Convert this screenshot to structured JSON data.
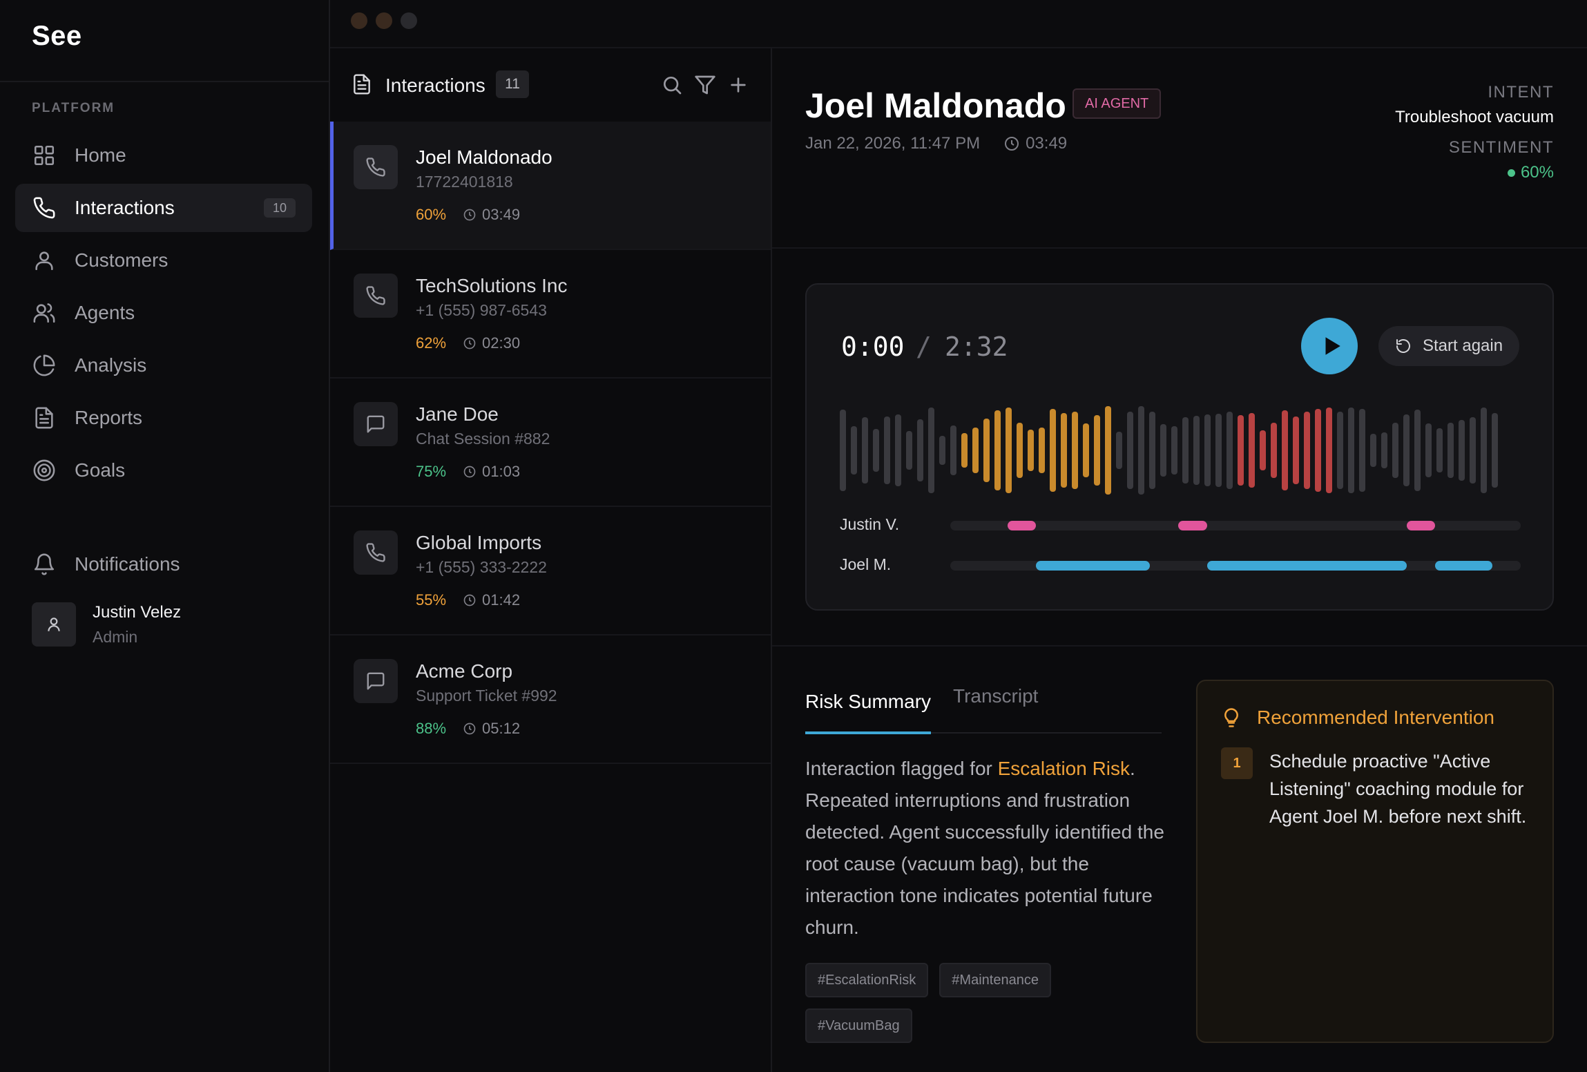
{
  "app": {
    "logo": "See"
  },
  "sidebar": {
    "section_label": "PLATFORM",
    "items": [
      {
        "label": "Home",
        "icon": "grid-icon"
      },
      {
        "label": "Interactions",
        "icon": "phone-icon",
        "badge": "10",
        "active": true
      },
      {
        "label": "Customers",
        "icon": "user-icon"
      },
      {
        "label": "Agents",
        "icon": "users-icon"
      },
      {
        "label": "Analysis",
        "icon": "pie-chart-icon"
      },
      {
        "label": "Reports",
        "icon": "document-icon"
      },
      {
        "label": "Goals",
        "icon": "target-icon"
      }
    ],
    "notifications_label": "Notifications",
    "user": {
      "name": "Justin Velez",
      "role": "Admin"
    }
  },
  "window_controls": {
    "colors": [
      "#3a2a1f",
      "#3a2a1f",
      "#2a2a2e"
    ]
  },
  "list": {
    "title": "Interactions",
    "count": "11",
    "rows": [
      {
        "name": "Joel Maldonado",
        "sub": "17722401818",
        "pct": "60%",
        "pct_color": "#f0a23a",
        "time": "03:49",
        "icon": "phone-icon",
        "active": true
      },
      {
        "name": "TechSolutions Inc",
        "sub": "+1 (555) 987-6543",
        "pct": "62%",
        "pct_color": "#f0a23a",
        "time": "02:30",
        "icon": "phone-icon"
      },
      {
        "name": "Jane Doe",
        "sub": "Chat Session #882",
        "pct": "75%",
        "pct_color": "#4cc38a",
        "time": "01:03",
        "icon": "chat-icon"
      },
      {
        "name": "Global Imports",
        "sub": "+1 (555) 333-2222",
        "pct": "55%",
        "pct_color": "#f0a23a",
        "time": "01:42",
        "icon": "phone-icon"
      },
      {
        "name": "Acme Corp",
        "sub": "Support Ticket #992",
        "pct": "88%",
        "pct_color": "#4cc38a",
        "time": "05:12",
        "icon": "chat-icon"
      }
    ]
  },
  "detail": {
    "name": "Joel Maldonado",
    "tag": "AI AGENT",
    "date": "Jan 22, 2026, 11:47 PM",
    "duration": "03:49",
    "intent_label": "INTENT",
    "intent_value": "Troubleshoot vacuum",
    "sentiment_label": "SENTIMENT",
    "sentiment_value": "60%",
    "player": {
      "current": "0:00",
      "separator": "/",
      "total": "2:32",
      "restart_label": "Start again",
      "tracks": [
        {
          "label": "Justin V.",
          "color": "#e2559c",
          "segments": [
            [
              0.1,
              0.15
            ],
            [
              0.4,
              0.45
            ],
            [
              0.8,
              0.85
            ]
          ]
        },
        {
          "label": "Joel M.",
          "color": "#3ea8d6",
          "segments": [
            [
              0.15,
              0.35
            ],
            [
              0.45,
              0.8
            ],
            [
              0.85,
              0.95
            ]
          ]
        }
      ],
      "colors": {
        "neutral": "#3a3a3f",
        "amber": "#c98a2c",
        "red": "#b84242"
      }
    },
    "tabs": {
      "active": "Risk Summary",
      "inactive": "Transcript"
    },
    "summary": {
      "prefix": "Interaction flagged for ",
      "highlight": "Escalation Risk",
      "suffix": ". Repeated interruptions and frustration detected. Agent successfully identified the root cause (vacuum bag), but the interaction tone indicates potential future churn."
    },
    "tags": [
      "#EscalationRisk",
      "#Maintenance",
      "#VacuumBag"
    ],
    "recommendation": {
      "title": "Recommended Intervention",
      "number": "1",
      "text": "Schedule proactive \"Active Listening\" coaching module for Agent Joel M. before next shift."
    }
  }
}
